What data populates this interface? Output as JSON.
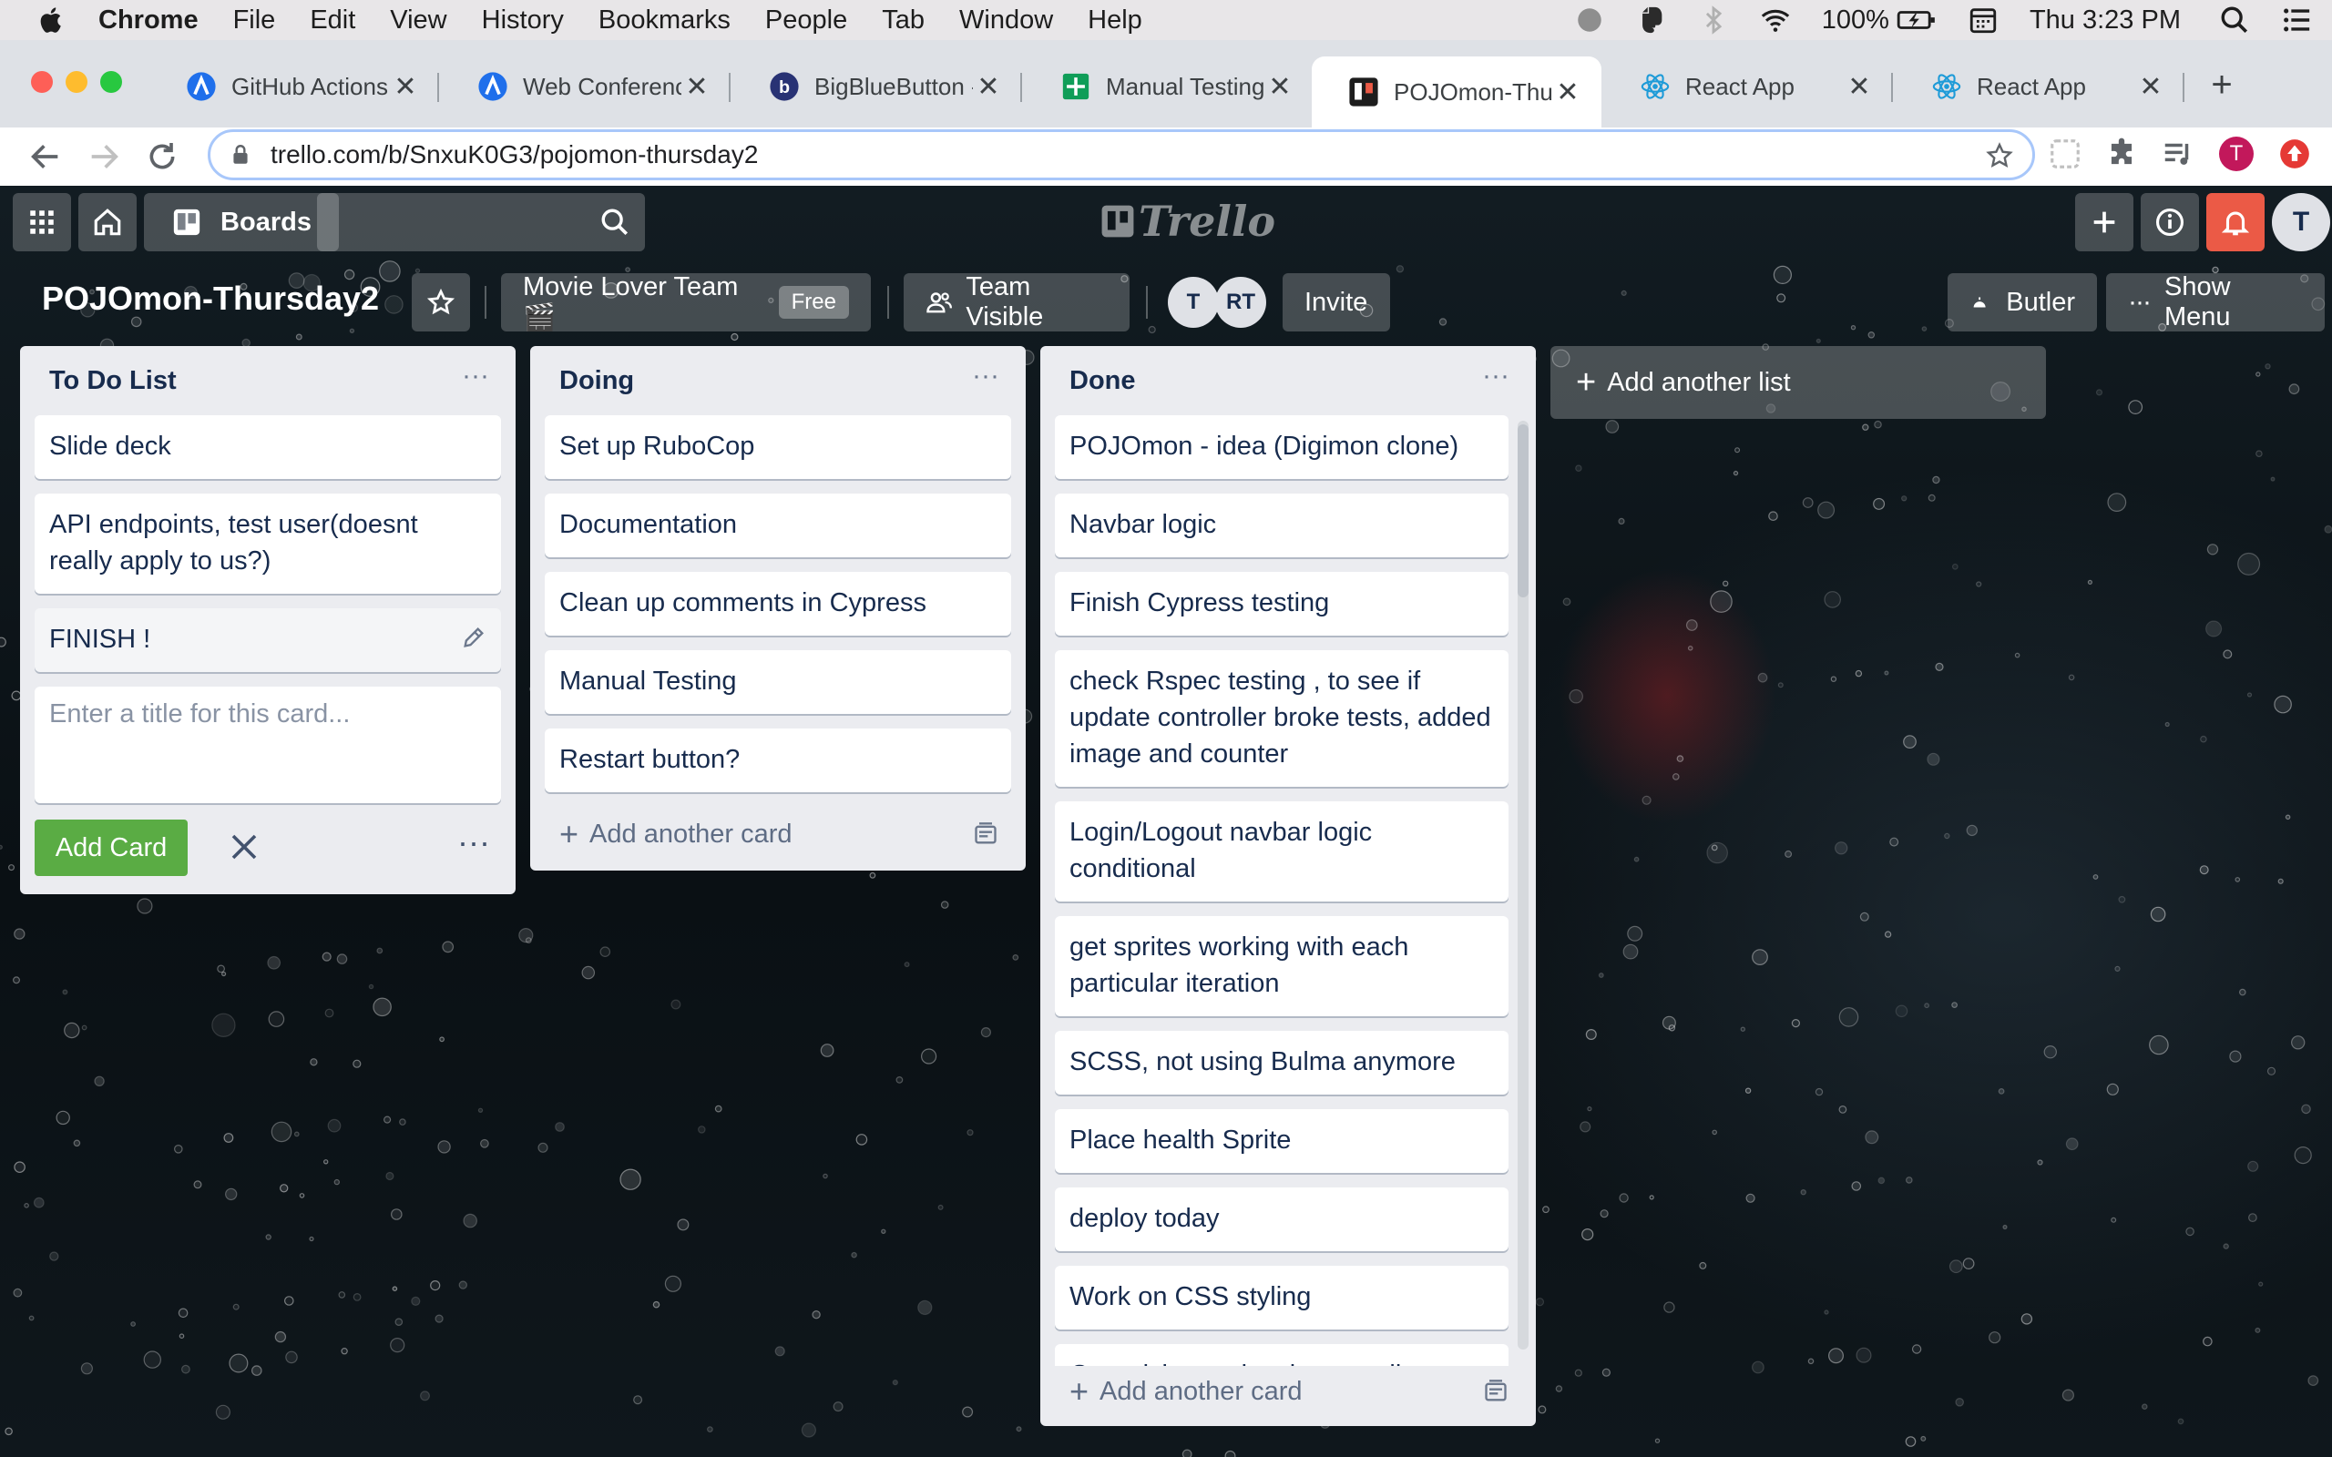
{
  "menubar": {
    "app": "Chrome",
    "items": [
      "File",
      "Edit",
      "View",
      "History",
      "Bookmarks",
      "People",
      "Tab",
      "Window",
      "Help"
    ],
    "battery": "100%",
    "clock": "Thu 3:23 PM"
  },
  "tabs": [
    {
      "title": "GitHub Actions: F",
      "icon": "github-actions-icon"
    },
    {
      "title": "Web Conference",
      "icon": "web-conference-icon"
    },
    {
      "title": "BigBlueButton - (",
      "icon": "bigbluebutton-icon"
    },
    {
      "title": "Manual Testing E",
      "icon": "sheets-icon"
    },
    {
      "title": "POJOmon-Thurs",
      "icon": "trello-icon",
      "active": true
    },
    {
      "title": "React App",
      "icon": "react-icon"
    },
    {
      "title": "React App",
      "icon": "react-icon"
    }
  ],
  "address": {
    "url": "trello.com/b/SnxuK0G3/pojomon-thursday2"
  },
  "profile_initial": "T",
  "trello": {
    "boards_label": "Boards",
    "logo_text": "Trello",
    "user_initial": "T",
    "board_title": "POJOmon-Thursday2",
    "team_name": "Movie Lover Team 🎬",
    "team_badge": "Free",
    "visibility": "Team Visible",
    "members": [
      "T",
      "RT"
    ],
    "invite_label": "Invite",
    "butler_label": "Butler",
    "show_menu_label": "Show Menu",
    "add_list_label": "Add another list"
  },
  "lists": [
    {
      "title": "To Do List",
      "cards": [
        "Slide deck",
        "API endpoints, test user(doesnt really apply to us?)",
        "FINISH !"
      ],
      "composer_placeholder": "Enter a title for this card...",
      "add_card_button": "Add Card"
    },
    {
      "title": "Doing",
      "cards": [
        "Set up RuboCop",
        "Documentation",
        "Clean up comments in Cypress",
        "Manual Testing",
        "Restart button?"
      ],
      "add_card_label": "Add another card"
    },
    {
      "title": "Done",
      "cards": [
        "POJOmon - idea (Digimon clone)",
        "Navbar logic",
        "Finish Cypress testing",
        "check Rspec testing , to see if update controller broke tests, added image and counter",
        "Login/Logout navbar logic conditional",
        "get sprites working with each particular iteration",
        "SCSS, not using Bulma anymore",
        "Place health Sprite",
        "deploy today",
        "Work on CSS styling",
        "Organising sprites into smaller"
      ],
      "add_card_label": "Add another card"
    }
  ],
  "colors": {
    "trello_green": "#5aac44",
    "list_bg": "#ebecf0",
    "notification_red": "#eb5a46"
  }
}
